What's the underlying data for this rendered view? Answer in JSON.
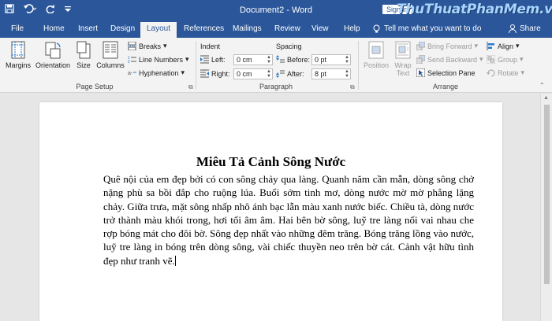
{
  "titlebar": {
    "title": "Document2  -  Word",
    "sign_in": "Sign in",
    "watermark": "ThuThuatPhanMem.vn"
  },
  "tabs": [
    {
      "label": "File"
    },
    {
      "label": "Home"
    },
    {
      "label": "Insert"
    },
    {
      "label": "Design"
    },
    {
      "label": "Layout",
      "active": true
    },
    {
      "label": "References"
    },
    {
      "label": "Mailings"
    },
    {
      "label": "Review"
    },
    {
      "label": "View"
    },
    {
      "label": "Help"
    }
  ],
  "tell_me": "Tell me what you want to do",
  "share": "Share",
  "page_setup": {
    "group_label": "Page Setup",
    "margins": "Margins",
    "orientation": "Orientation",
    "size": "Size",
    "columns": "Columns",
    "breaks": "Breaks",
    "line_numbers": "Line Numbers",
    "hyphenation": "Hyphenation"
  },
  "paragraph": {
    "group_label": "Paragraph",
    "indent_label": "Indent",
    "spacing_label": "Spacing",
    "left_label": "Left:",
    "left_value": "0 cm",
    "right_label": "Right:",
    "right_value": "0 cm",
    "before_label": "Before:",
    "before_value": "0 pt",
    "after_label": "After:",
    "after_value": "8 pt"
  },
  "arrange": {
    "group_label": "Arrange",
    "position": "Position",
    "wrap_text": "Wrap Text",
    "bring_forward": "Bring Forward",
    "send_backward": "Send Backward",
    "selection_pane": "Selection Pane",
    "align": "Align",
    "group": "Group",
    "rotate": "Rotate"
  },
  "document": {
    "heading": "Miêu Tả Cảnh Sông Nước",
    "body": "Quê nội của em đẹp bởi có con sông chảy qua làng. Quanh năm cần mẫn, dòng sông chở nặng phù sa bồi đắp cho ruộng lúa. Buổi sớm tinh mơ, dòng nước mờ mờ phẳng lặng chảy. Giữa trưa, mặt sông nhấp nhô ánh bạc lẫn màu xanh nước biếc. Chiều tà, dòng nước trở thành màu khói trong, hơi tối âm âm. Hai bên bờ sông, luỹ tre làng nối vai nhau che rợp bóng mát cho đôi bờ. Sông đẹp nhất vào những đêm trăng. Bóng trăng lồng vào nước, luỹ tre làng in bóng trên dòng sông, vài chiếc thuyền neo trên bờ cát. Cảnh vật hữu tình đẹp như tranh vẽ."
  },
  "colors": {
    "brand": "#2b579a",
    "ribbon": "#f3f3f3",
    "workspace": "#e6e6e6"
  }
}
